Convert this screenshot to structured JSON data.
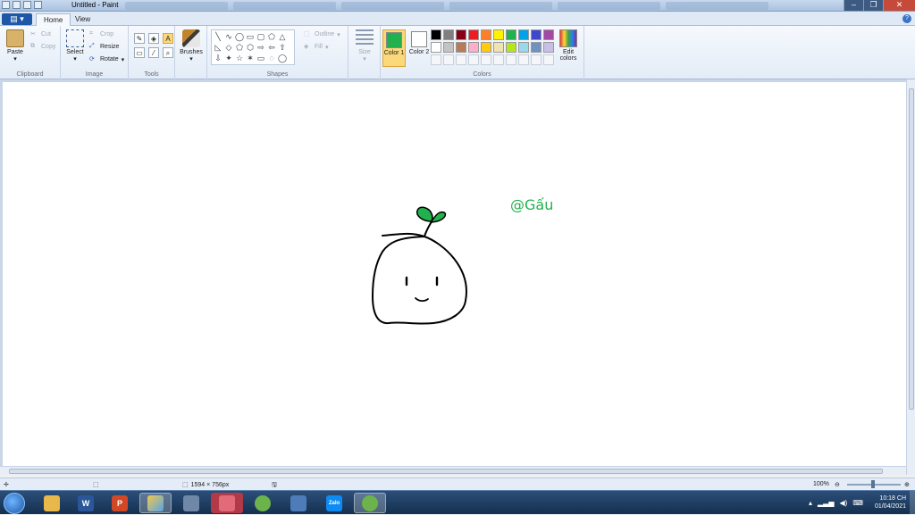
{
  "window": {
    "title": "Untitled - Paint",
    "controls": [
      "–",
      "❐",
      "✕"
    ]
  },
  "tabs": {
    "file": "▤ ▾",
    "home": "Home",
    "view": "View",
    "help": "?"
  },
  "clipboard": {
    "paste": "Paste",
    "cut": "Cut",
    "copy": "Copy",
    "label": "Clipboard"
  },
  "image": {
    "select": "Select",
    "crop": "Crop",
    "resize": "Resize",
    "rotate": "Rotate",
    "label": "Image"
  },
  "tools": {
    "label": "Tools",
    "items": [
      "✎",
      "◈",
      "A",
      "▭",
      "⁄",
      "⌕"
    ]
  },
  "brushes": {
    "label": "Brushes"
  },
  "shapes": {
    "label": "Shapes",
    "items": [
      "╲",
      "∿",
      "◯",
      "▭",
      "▢",
      "⬠",
      "△",
      "◺",
      "◇",
      "⬠",
      "⬡",
      "⇨",
      "⇦",
      "⇧",
      "⇩",
      "✦",
      "☆",
      "✶",
      "▭",
      "◌",
      "◯"
    ],
    "outline": "Outline",
    "fill": "Fill"
  },
  "size": {
    "label": "Size"
  },
  "colors": {
    "label": "Colors",
    "color1": "Color 1",
    "color2": "Color 2",
    "color1_value": "#22b14c",
    "color2_value": "#ffffff",
    "edit": "Edit colors",
    "palette_row1": [
      "#000000",
      "#7f7f7f",
      "#880015",
      "#ed1c24",
      "#ff7f27",
      "#fff200",
      "#22b14c",
      "#00a2e8",
      "#3f48cc",
      "#a349a4"
    ],
    "palette_row2": [
      "#ffffff",
      "#c3c3c3",
      "#b97a57",
      "#ffaec9",
      "#ffc90e",
      "#efe4b0",
      "#b5e61d",
      "#99d9ea",
      "#7092be",
      "#c8bfe7"
    ]
  },
  "canvas": {
    "signature": "@Gấu",
    "signature_color": "#22b14c",
    "leaf_color": "#22b14c"
  },
  "status": {
    "dimensions": "1594 × 756px",
    "zoom": "100%"
  },
  "taskbar": {
    "apps": [
      "Explorer",
      "W",
      "P",
      "Chrome",
      "Calc",
      "Snip",
      "Coc",
      "Word",
      "Zalo",
      "Coc"
    ],
    "time": "10:18 CH",
    "date": "01/04/2021"
  }
}
